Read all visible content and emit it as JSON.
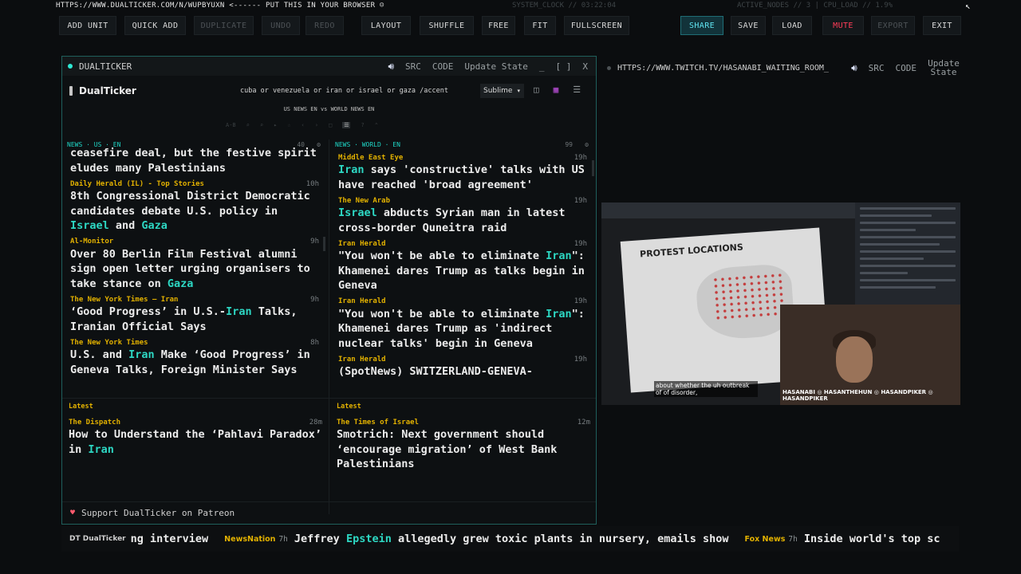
{
  "topbar": {
    "url_note": "HTTPS://WWW.DUALTICKER.COM/N/WUPBYUXN <------ PUT THIS IN YOUR BROWSER ☺",
    "clock": "SYSTEM_CLOCK // 03:22:04",
    "nodes": "ACTIVE_NODES // 3 | CPU_LOAD // 1.9%"
  },
  "toolbar": {
    "add_unit": "ADD UNIT",
    "quick_add": "QUICK ADD",
    "duplicate": "DUPLICATE",
    "undo": "UNDO",
    "redo": "REDO",
    "layout": "LAYOUT",
    "shuffle": "SHUFFLE",
    "free": "FREE",
    "fit": "FIT",
    "fullscreen": "FULLSCREEN",
    "share": "SHARE",
    "save": "SAVE",
    "load": "LOAD",
    "mute": "MUTE",
    "export": "EXPORT",
    "exit": "EXIT"
  },
  "left_panel": {
    "title": "DUALTICKER",
    "src": "SRC",
    "code": "CODE",
    "update": "Update State",
    "min": "_",
    "max": "[ ]",
    "close": "X",
    "app_name": "DualTicker",
    "search_value": "cuba or venezuela or iran or israel or gaza /accent",
    "sublime": "Sublime",
    "subheader": "US NEWS EN vs WORLD NEWS EN",
    "minitools": [
      "A-B",
      "⌕",
      "⌕",
      "▸",
      "☆",
      "‹",
      "›",
      "□",
      "☰",
      "?",
      "⌃"
    ],
    "us": {
      "header": "NEWS · US · EN",
      "count": "40",
      "items": [
        {
          "source": "",
          "time": "",
          "title_parts": [
            {
              "t": "ceasefire deal, but the festive spirit eludes many Palestinians",
              "h": false
            }
          ]
        },
        {
          "source": "Daily Herald (IL) - Top Stories",
          "time": "10h",
          "title_parts": [
            {
              "t": "8th Congressional District Democratic candidates debate U.S. policy in ",
              "h": false
            },
            {
              "t": "Israel",
              "h": true
            },
            {
              "t": " and ",
              "h": false
            },
            {
              "t": "Gaza",
              "h": true
            }
          ]
        },
        {
          "source": "Al-Monitor",
          "time": "9h",
          "title_parts": [
            {
              "t": "Over 80 Berlin Film Festival alumni sign open letter urging organisers to take stance on ",
              "h": false
            },
            {
              "t": "Gaza",
              "h": true
            }
          ]
        },
        {
          "source": "The New York Times — Iran",
          "time": "9h",
          "title_parts": [
            {
              "t": "‘Good Progress’ in U.S.-",
              "h": false
            },
            {
              "t": "Iran",
              "h": true
            },
            {
              "t": " Talks, Iranian Official Says",
              "h": false
            }
          ]
        },
        {
          "source": "The New York Times",
          "time": "8h",
          "title_parts": [
            {
              "t": "U.S. and ",
              "h": false
            },
            {
              "t": "Iran",
              "h": true
            },
            {
              "t": " Make ‘Good Progress’ in Geneva Talks, Foreign Minister Says",
              "h": false
            }
          ]
        }
      ]
    },
    "world": {
      "header": "NEWS · WORLD · EN",
      "count": "99",
      "items": [
        {
          "source": "Middle East Eye",
          "time": "19h",
          "title_parts": [
            {
              "t": "Iran",
              "h": true
            },
            {
              "t": " says 'constructive' talks with US have reached 'broad agreement'",
              "h": false
            }
          ]
        },
        {
          "source": "The New Arab",
          "time": "19h",
          "title_parts": [
            {
              "t": "Israel",
              "h": true
            },
            {
              "t": " abducts Syrian man in latest cross-border Quneitra raid",
              "h": false
            }
          ]
        },
        {
          "source": "Iran Herald",
          "time": "19h",
          "title_parts": [
            {
              "t": "\"You won't be able to eliminate ",
              "h": false
            },
            {
              "t": "Iran",
              "h": true
            },
            {
              "t": "\": Khamenei dares Trump as talks begin in Geneva",
              "h": false
            }
          ]
        },
        {
          "source": "Iran Herald",
          "time": "19h",
          "title_parts": [
            {
              "t": "\"You won't be able to eliminate ",
              "h": false
            },
            {
              "t": "Iran",
              "h": true
            },
            {
              "t": "\": Khamenei dares Trump as 'indirect nuclear talks' begin in Geneva",
              "h": false
            }
          ]
        },
        {
          "source": "Iran Herald",
          "time": "19h",
          "title_parts": [
            {
              "t": "(SpotNews) SWITZERLAND-GENEVA-",
              "h": false
            }
          ]
        }
      ]
    },
    "latest_label_left": "Latest",
    "latest_label_right": "Latest",
    "latest_left": {
      "source": "The Dispatch",
      "time": "28m",
      "title_parts": [
        {
          "t": "How to Understand the ‘Pahlavi Paradox’ in ",
          "h": false
        },
        {
          "t": "Iran",
          "h": true
        }
      ]
    },
    "latest_right": {
      "source": "The Times of Israel",
      "time": "12m",
      "title_parts": [
        {
          "t": "Smotrich: Next government should ‘encourage migration’ of West Bank Palestinians",
          "h": false
        }
      ]
    },
    "patreon": "Support DualTicker on Patreon"
  },
  "right_panel": {
    "title": "HTTPS://WWW.TWITCH.TV/HASANABI_WAITING_ROOM_",
    "src": "SRC",
    "code": "CODE",
    "update": "Update State",
    "map_title": "PROTEST LOCATIONS",
    "caption": "about whether the uh outbreak of of disorder,",
    "cam_label": "HASANABI ◎ HASANTHEHUN ◎ HASANDPIKER ◎ HASANDPIKER"
  },
  "ticker": {
    "logo": "DT DualTicker",
    "lead": "ng interview",
    "items": [
      {
        "source": "NewsNation",
        "time": "7h",
        "title_parts": [
          {
            "t": "Jeffrey ",
            "h": false
          },
          {
            "t": "Epstein",
            "h": true
          },
          {
            "t": " allegedly grew toxic plants in nursery, emails show",
            "h": false
          }
        ]
      },
      {
        "source": "Fox News",
        "time": "7h",
        "title_parts": [
          {
            "t": "Inside world's top sc",
            "h": false
          }
        ]
      }
    ]
  },
  "colors": {
    "accent": "#2dd7c3",
    "source": "#e2b100",
    "mute": "#ff3d58",
    "share": "#5fe3f0"
  }
}
